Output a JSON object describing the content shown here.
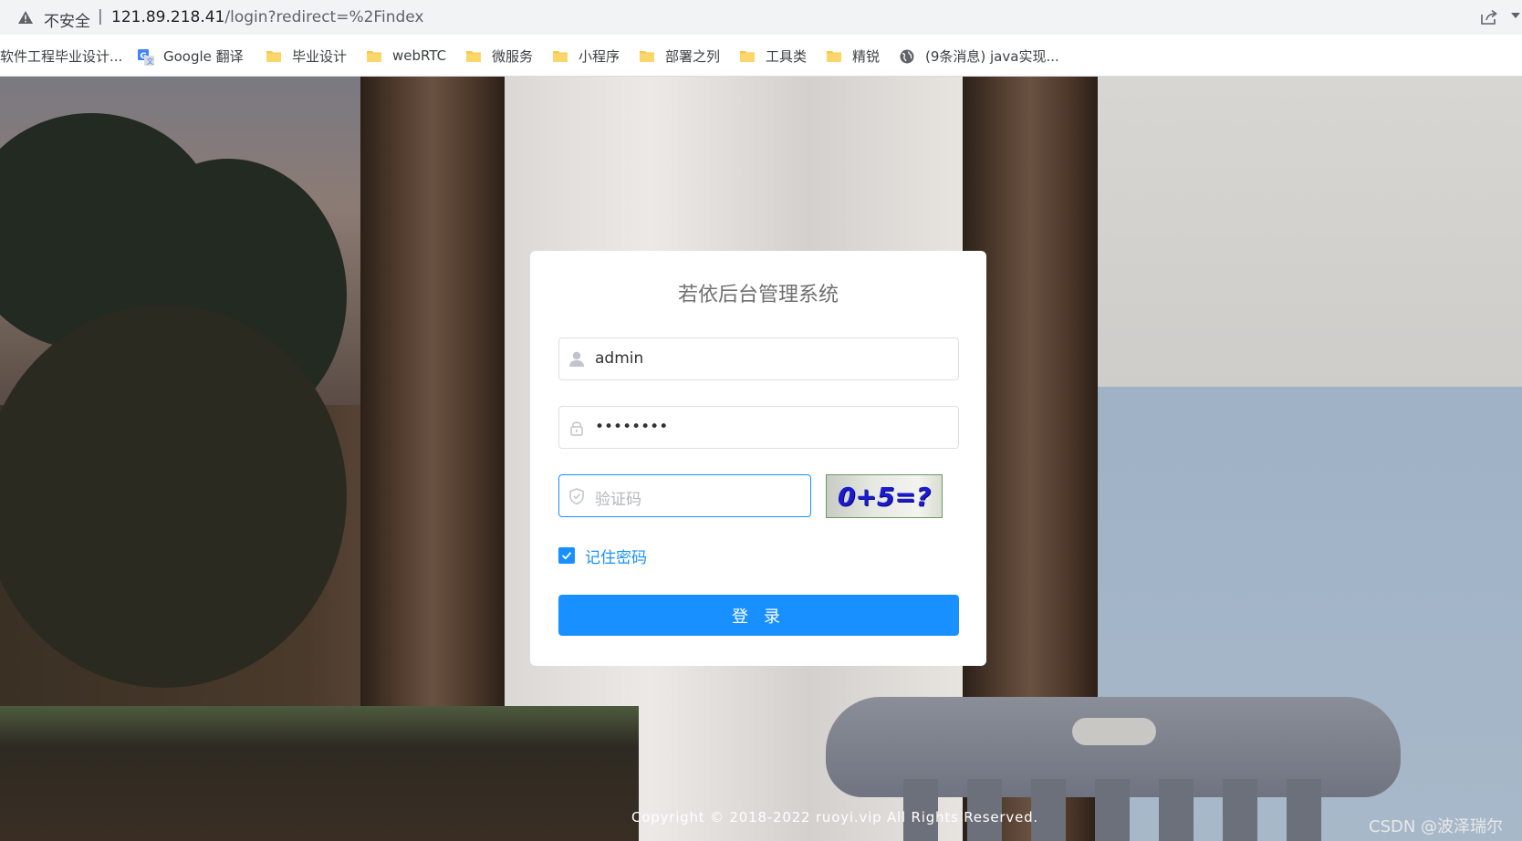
{
  "browser": {
    "security_label": "不安全",
    "separator": "|",
    "url_host": "121.89.218.41",
    "url_path": "/login?redirect=%2Findex",
    "icons": [
      "warning-icon",
      "share-icon",
      "menu-caret-icon"
    ]
  },
  "bookmarks": [
    {
      "label": "软件工程毕业设计...",
      "icon": "none"
    },
    {
      "label": "Google 翻译",
      "icon": "google-translate-icon"
    },
    {
      "label": "毕业设计",
      "icon": "folder-icon"
    },
    {
      "label": "webRTC",
      "icon": "folder-icon"
    },
    {
      "label": "微服务",
      "icon": "folder-icon"
    },
    {
      "label": "小程序",
      "icon": "folder-icon"
    },
    {
      "label": "部署之列",
      "icon": "folder-icon"
    },
    {
      "label": "工具类",
      "icon": "folder-icon"
    },
    {
      "label": "精锐",
      "icon": "folder-icon"
    },
    {
      "label": "(9条消息) java实现...",
      "icon": "globe-icon"
    }
  ],
  "login": {
    "title": "若依后台管理系统",
    "username_value": "admin",
    "password_value": "••••••••",
    "captcha_placeholder": "验证码",
    "captcha_image_text": "0+5=?",
    "remember_label": "记住密码",
    "remember_checked": true,
    "submit_label": "登 录"
  },
  "footer": {
    "copyright": "Copyright © 2018-2022 ruoyi.vip All Rights Reserved.",
    "watermark": "CSDN @波泽瑞尔"
  },
  "colors": {
    "primary": "#1890ff",
    "card_bg": "#ffffff",
    "title_text": "#707070"
  }
}
